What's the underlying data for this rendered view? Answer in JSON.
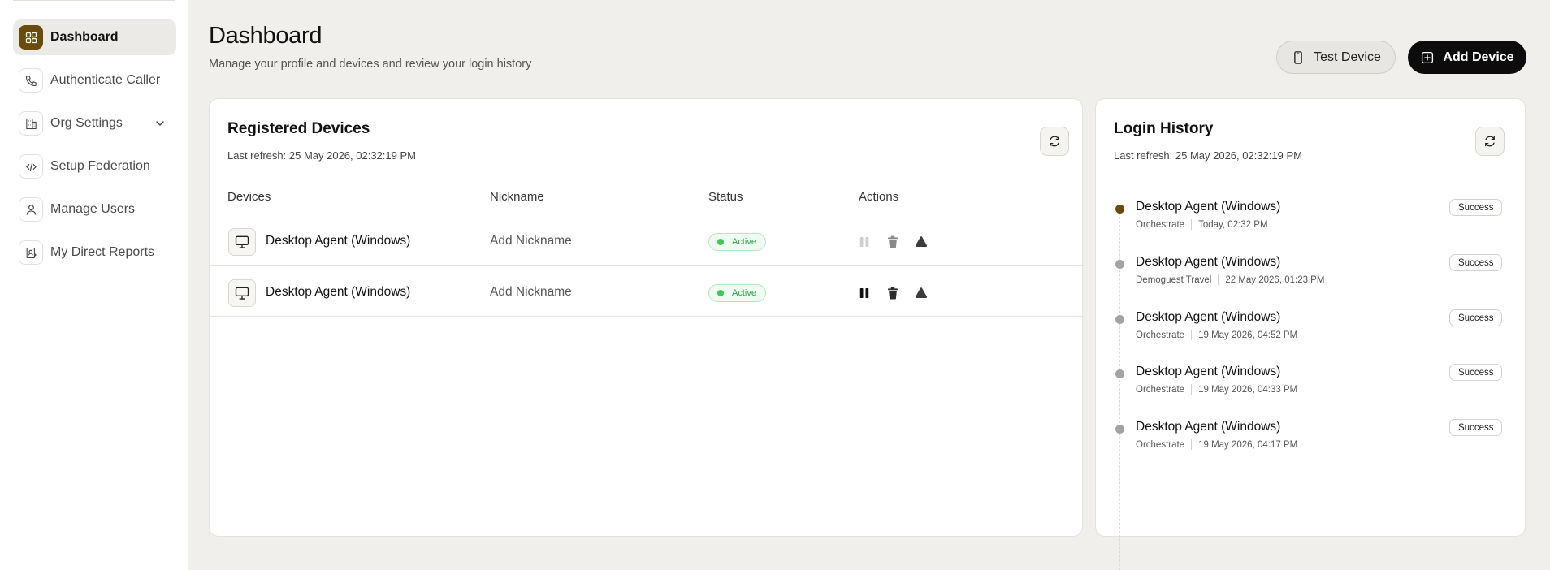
{
  "sidebar": {
    "items": [
      {
        "label": "Dashboard",
        "icon": "grid-icon",
        "active": true
      },
      {
        "label": "Authenticate Caller",
        "icon": "phone-icon"
      },
      {
        "label": "Org Settings",
        "icon": "building-icon",
        "expandable": true
      },
      {
        "label": "Setup Federation",
        "icon": "code-icon"
      },
      {
        "label": "Manage Users",
        "icon": "user-icon"
      },
      {
        "label": "My Direct Reports",
        "icon": "reports-icon"
      }
    ]
  },
  "header": {
    "title": "Dashboard",
    "subtitle": "Manage your profile and devices and review your login history",
    "test_device_label": "Test Device",
    "add_device_label": "Add Device"
  },
  "devices": {
    "title": "Registered Devices",
    "last_refresh": "Last refresh: 25 May 2026, 02:32:19 PM",
    "columns": [
      "Devices",
      "Nickname",
      "Status",
      "Actions"
    ],
    "rows": [
      {
        "name": "Desktop Agent (Windows)",
        "nickname": "Add Nickname",
        "status": "Active",
        "pause_enabled": false
      },
      {
        "name": "Desktop Agent (Windows)",
        "nickname": "Add Nickname",
        "status": "Active",
        "pause_enabled": true
      }
    ]
  },
  "history": {
    "title": "Login History",
    "last_refresh": "Last refresh: 25 May 2026, 02:32:19 PM",
    "items": [
      {
        "name": "Desktop Agent (Windows)",
        "org": "Orchestrate",
        "time": "Today, 02:32 PM",
        "result": "Success",
        "current": true
      },
      {
        "name": "Desktop Agent (Windows)",
        "org": "Demoguest Travel",
        "time": "22 May 2026, 01:23 PM",
        "result": "Success"
      },
      {
        "name": "Desktop Agent (Windows)",
        "org": "Orchestrate",
        "time": "19 May 2026, 04:52 PM",
        "result": "Success"
      },
      {
        "name": "Desktop Agent (Windows)",
        "org": "Orchestrate",
        "time": "19 May 2026, 04:33 PM",
        "result": "Success"
      },
      {
        "name": "Desktop Agent (Windows)",
        "org": "Orchestrate",
        "time": "19 May 2026, 04:17 PM",
        "result": "Success"
      }
    ]
  },
  "colors": {
    "brand": "#6b4b0d",
    "active_green": "#3bc95b",
    "primary_button": "#0c0c0c"
  }
}
